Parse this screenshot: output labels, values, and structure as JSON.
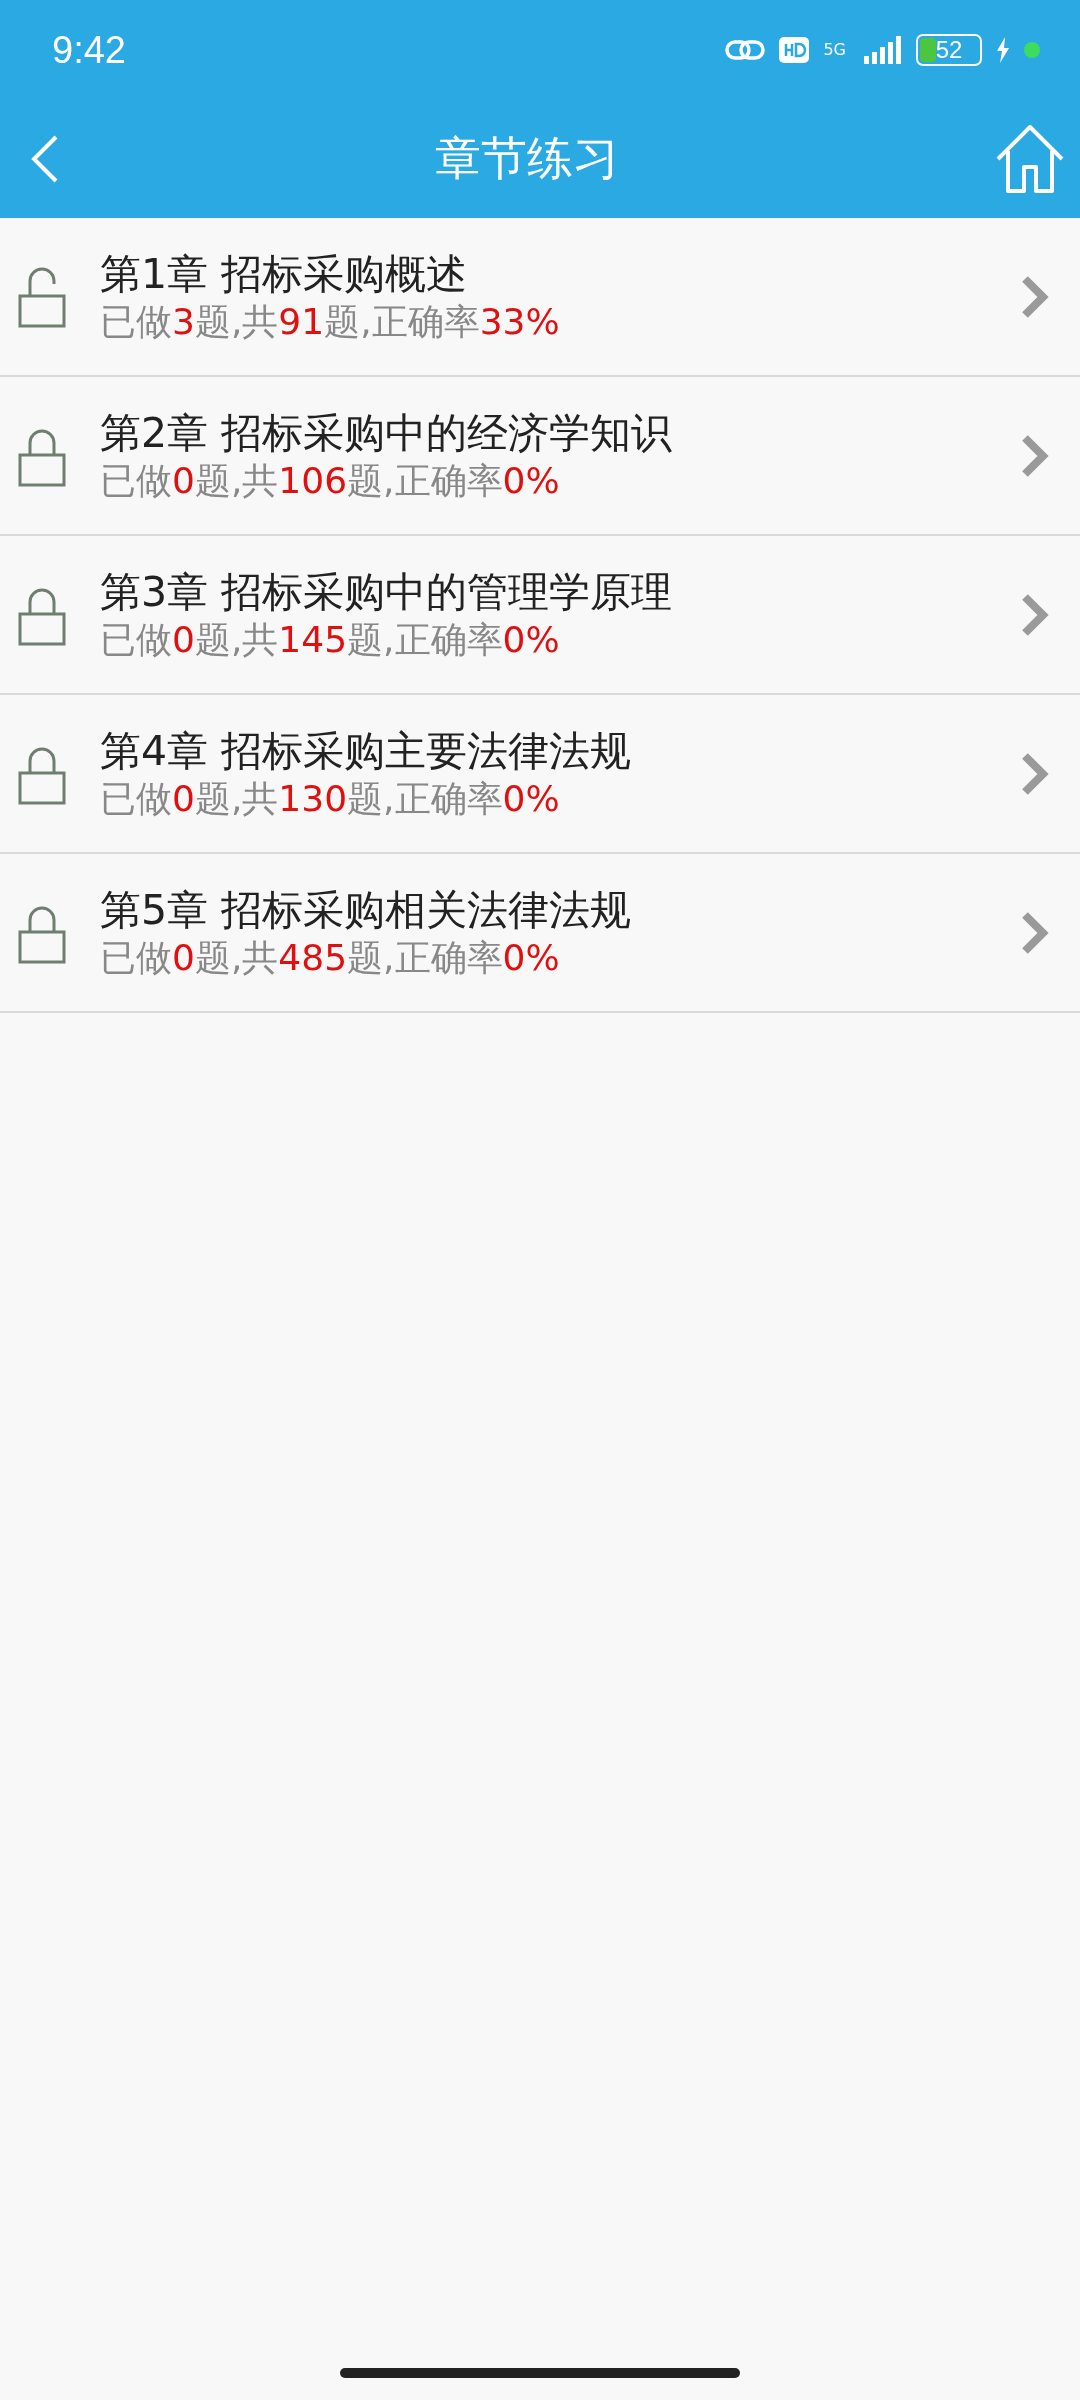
{
  "status_bar": {
    "time": "9:42",
    "network": "5G",
    "battery": "52"
  },
  "header": {
    "title": "章节练习"
  },
  "chapters": [
    {
      "title": "第1章 招标采购概述",
      "locked": false,
      "stats": [
        {
          "text": "已做",
          "highlight": false
        },
        {
          "text": "3",
          "highlight": true
        },
        {
          "text": "题,共",
          "highlight": false
        },
        {
          "text": "91",
          "highlight": true
        },
        {
          "text": "题,正确率",
          "highlight": false
        },
        {
          "text": "33%",
          "highlight": true
        }
      ]
    },
    {
      "title": "第2章 招标采购中的经济学知识",
      "locked": true,
      "stats": [
        {
          "text": "已做",
          "highlight": false
        },
        {
          "text": "0",
          "highlight": true
        },
        {
          "text": "题,共",
          "highlight": false
        },
        {
          "text": "106",
          "highlight": true
        },
        {
          "text": "题,正确率",
          "highlight": false
        },
        {
          "text": "0%",
          "highlight": true
        }
      ]
    },
    {
      "title": "第3章 招标采购中的管理学原理",
      "locked": true,
      "stats": [
        {
          "text": "已做",
          "highlight": false
        },
        {
          "text": "0",
          "highlight": true
        },
        {
          "text": "题,共",
          "highlight": false
        },
        {
          "text": "145",
          "highlight": true
        },
        {
          "text": "题,正确率",
          "highlight": false
        },
        {
          "text": "0%",
          "highlight": true
        }
      ]
    },
    {
      "title": "第4章 招标采购主要法律法规",
      "locked": true,
      "stats": [
        {
          "text": "已做",
          "highlight": false
        },
        {
          "text": "0",
          "highlight": true
        },
        {
          "text": "题,共",
          "highlight": false
        },
        {
          "text": "130",
          "highlight": true
        },
        {
          "text": "题,正确率",
          "highlight": false
        },
        {
          "text": "0%",
          "highlight": true
        }
      ]
    },
    {
      "title": "第5章 招标采购相关法律法规",
      "locked": true,
      "stats": [
        {
          "text": "已做",
          "highlight": false
        },
        {
          "text": "0",
          "highlight": true
        },
        {
          "text": "题,共",
          "highlight": false
        },
        {
          "text": "485",
          "highlight": true
        },
        {
          "text": "题,正确率",
          "highlight": false
        },
        {
          "text": "0%",
          "highlight": true
        }
      ]
    }
  ]
}
